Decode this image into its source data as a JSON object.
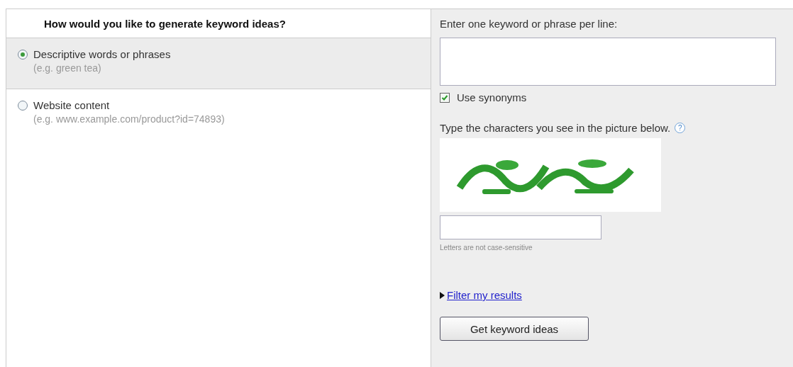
{
  "left_panel": {
    "heading": "How would you like to generate keyword ideas?",
    "options": [
      {
        "label": "Descriptive words or phrases",
        "example": "(e.g. green tea)",
        "selected": true
      },
      {
        "label": "Website content",
        "example": "(e.g. www.example.com/product?id=74893)",
        "selected": false
      }
    ]
  },
  "right_panel": {
    "keywords_label": "Enter one keyword or phrase per line:",
    "use_synonyms": {
      "label": "Use synonyms",
      "checked": true
    },
    "captcha_prompt": "Type the characters you see in the picture below.",
    "help_icon": "?",
    "captcha_hint": "Letters are not case-sensitive",
    "filter_link": "Filter my results",
    "submit_button": "Get keyword ideas"
  }
}
